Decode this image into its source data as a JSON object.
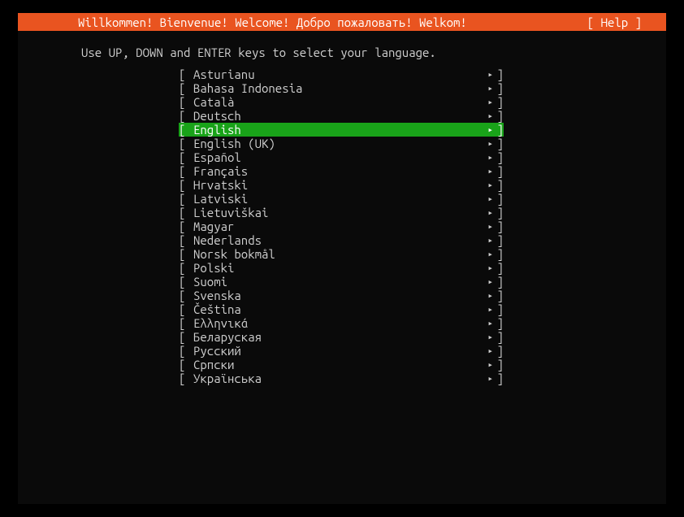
{
  "header": {
    "title": "Willkommen! Bienvenue! Welcome! Добро пожаловать! Welkom!",
    "help": "[ Help ]"
  },
  "instruction": "Use UP, DOWN and ENTER keys to select your language.",
  "languages": [
    {
      "label": "Asturianu",
      "selected": false
    },
    {
      "label": "Bahasa Indonesia",
      "selected": false
    },
    {
      "label": "Català",
      "selected": false
    },
    {
      "label": "Deutsch",
      "selected": false
    },
    {
      "label": "English",
      "selected": true
    },
    {
      "label": "English (UK)",
      "selected": false
    },
    {
      "label": "Español",
      "selected": false
    },
    {
      "label": "Français",
      "selected": false
    },
    {
      "label": "Hrvatski",
      "selected": false
    },
    {
      "label": "Latviski",
      "selected": false
    },
    {
      "label": "Lietuviškai",
      "selected": false
    },
    {
      "label": "Magyar",
      "selected": false
    },
    {
      "label": "Nederlands",
      "selected": false
    },
    {
      "label": "Norsk bokmål",
      "selected": false
    },
    {
      "label": "Polski",
      "selected": false
    },
    {
      "label": "Suomi",
      "selected": false
    },
    {
      "label": "Svenska",
      "selected": false
    },
    {
      "label": "Čeština",
      "selected": false
    },
    {
      "label": "Ελληνικά",
      "selected": false
    },
    {
      "label": "Беларуская",
      "selected": false
    },
    {
      "label": "Русский",
      "selected": false
    },
    {
      "label": "Српски",
      "selected": false
    },
    {
      "label": "Українська",
      "selected": false
    }
  ],
  "brackets": {
    "left": "[ ",
    "right": "]",
    "arrow": "▸"
  }
}
